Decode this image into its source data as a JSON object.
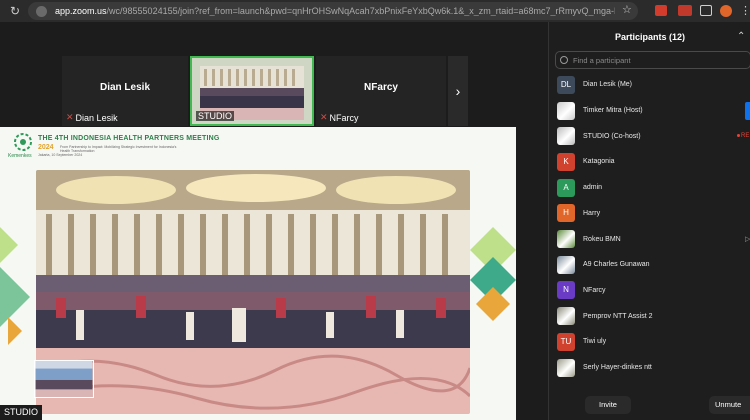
{
  "browser": {
    "url_host": "app.zoom.us",
    "url_path": "/wc/98555024155/join?ref_from=launch&pwd=qnHrOHSwNqAcah7xbPnixFeYxbQw6k.1&_x_zm_rtaid=a68mc7_rRmyvQ_mga-BPcg.17..."
  },
  "thumbnails": [
    {
      "center_name": "Dian Lesik",
      "tag_name": "Dian Lesik",
      "muted": true
    },
    {
      "center_name": "",
      "tag_name": "STUDIO",
      "muted": false
    },
    {
      "center_name": "NFarcy",
      "tag_name": "NFarcy",
      "muted": true
    }
  ],
  "shared_screen": {
    "org": "Kemenkes",
    "title": "THE 4TH INDONESIA HEALTH PARTNERS MEETING",
    "year": "2024",
    "subtitle": "From Partnership to Impact: Mobilizing Strategic Investment for Indonesia's Health Transformation",
    "date": "Jakarta, 10 September 2024",
    "presenter_tag": "STUDIO"
  },
  "participants_panel": {
    "title": "Participants (12)",
    "search_placeholder": "Find a participant",
    "participants": [
      {
        "initials": "DL",
        "name": "Dian Lesik (Me)",
        "avatar_color": "#3c4a5c",
        "photo": false
      },
      {
        "initials": "",
        "name": "Timker Mitra (Host)",
        "avatar_color": "#c9c9c9",
        "photo": true
      },
      {
        "initials": "",
        "name": "STUDIO (Co-host)",
        "avatar_color": "#b9b9b9",
        "photo": true
      },
      {
        "initials": "K",
        "name": "Katagonia",
        "avatar_color": "#d0412e",
        "photo": false
      },
      {
        "initials": "A",
        "name": "admin",
        "avatar_color": "#2c9a5a",
        "photo": false
      },
      {
        "initials": "H",
        "name": "Harry",
        "avatar_color": "#e0662a",
        "photo": false
      },
      {
        "initials": "",
        "name": "Rokeu BMN",
        "avatar_color": "#5a8a3a",
        "photo": true
      },
      {
        "initials": "",
        "name": "A9 Charles Gunawan",
        "avatar_color": "#7a8a9a",
        "photo": true
      },
      {
        "initials": "N",
        "name": "NFarcy",
        "avatar_color": "#6a3bc4",
        "photo": false
      },
      {
        "initials": "",
        "name": "Pemprov NTT Assist 2",
        "avatar_color": "#8a8a7a",
        "photo": true
      },
      {
        "initials": "TU",
        "name": "Tiwi uly",
        "avatar_color": "#d0412e",
        "photo": false
      },
      {
        "initials": "",
        "name": "Serly Hayer-dinkes ntt",
        "avatar_color": "#9a9a8a",
        "photo": true
      }
    ],
    "rec_label": "RE",
    "invite_label": "Invite",
    "unmute_label": "Unmute"
  }
}
